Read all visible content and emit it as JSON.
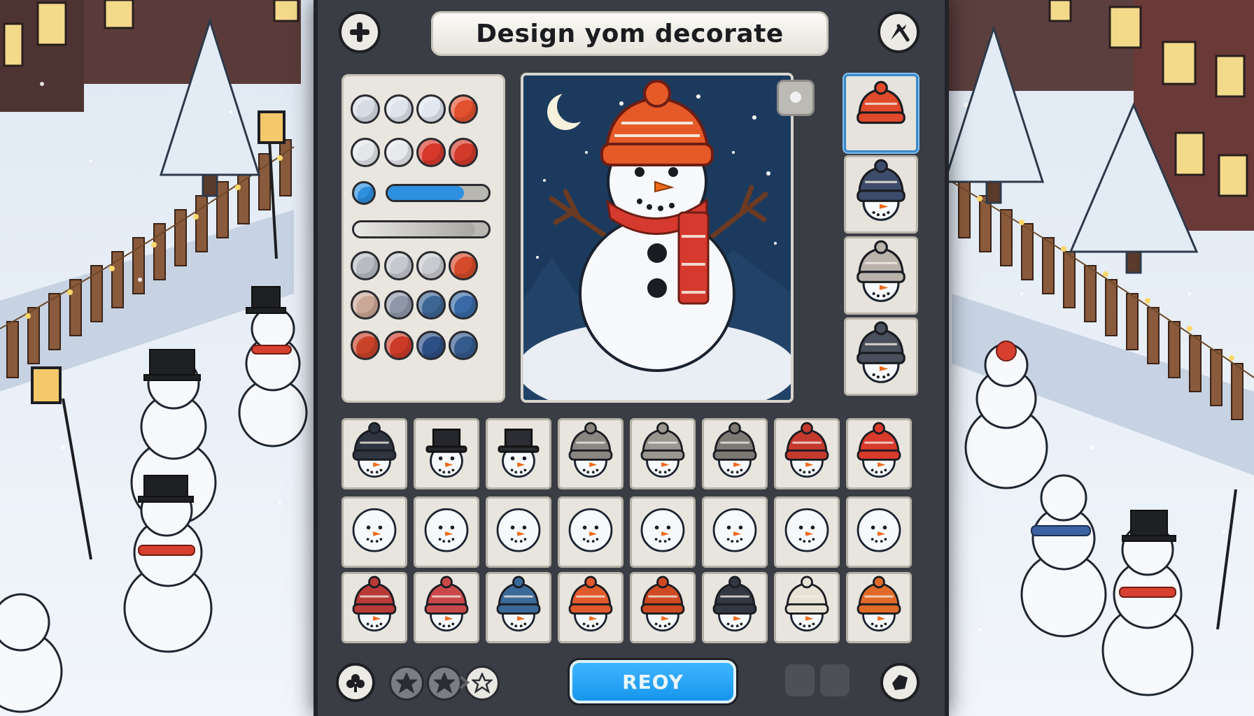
{
  "header": {
    "title": "Design  yom decorate",
    "left_icon": "plus-icon",
    "right_icon": "tool-icon"
  },
  "palette": {
    "rows": [
      [
        "#d7dce4",
        "#dfe4ec",
        "#e2e8f2",
        "#e2502e"
      ],
      [
        "#e4e6ea",
        "#e7e9ed",
        "#d8382c",
        "#d23a2a"
      ],
      [
        "#b8bcc2",
        "#c5c8cd",
        "#c9cbd0",
        "#d44a2a"
      ],
      [
        "#caa897",
        "#8f97a8",
        "#3e6695",
        "#3a6aa6"
      ],
      [
        "#c9432a",
        "#cc3b28",
        "#2c4f86",
        "#355a8c"
      ]
    ],
    "slider_dot_color": "#2d8fe0",
    "slider1_level": 0.76,
    "slider2_level": 0.9
  },
  "preview": {
    "hat_color": "#e65a28",
    "scarf_color": "#d63a2e",
    "sky_color": "#1b3a5e"
  },
  "side_hats": [
    {
      "name": "red-beanie",
      "color": "#e04a2a",
      "with_face": false
    },
    {
      "name": "navy-beanie",
      "color": "#3d4c6a",
      "with_face": true
    },
    {
      "name": "grey-pompom-beanie",
      "color": "#b9b3ab",
      "with_face": true
    },
    {
      "name": "dark-knit-beanie",
      "color": "#4a4f5c",
      "with_face": true
    }
  ],
  "grid": {
    "rows": [
      [
        {
          "hat": "beanie",
          "color": "#2e3440"
        },
        {
          "hat": "tophat",
          "color": "#26272c"
        },
        {
          "hat": "tophat",
          "color": "#2c2d33"
        },
        {
          "hat": "beanie",
          "color": "#8a8682"
        },
        {
          "hat": "beanie",
          "color": "#9a9690"
        },
        {
          "hat": "beanie",
          "color": "#7c7874"
        },
        {
          "hat": "beanie",
          "color": "#c53a2e"
        },
        {
          "hat": "beanie",
          "color": "#d93a2c"
        }
      ],
      [
        {
          "hat": "none"
        },
        {
          "hat": "none"
        },
        {
          "hat": "none"
        },
        {
          "hat": "none"
        },
        {
          "hat": "none"
        },
        {
          "hat": "none"
        },
        {
          "hat": "none"
        },
        {
          "hat": "none"
        }
      ],
      [
        {
          "hat": "beanie",
          "color": "#b83a38"
        },
        {
          "hat": "beanie",
          "color": "#c9494a"
        },
        {
          "hat": "beanie",
          "color": "#3a6a9a"
        },
        {
          "hat": "beanie",
          "color": "#e25a2c"
        },
        {
          "hat": "beanie",
          "color": "#cf4a22"
        },
        {
          "hat": "beanie",
          "color": "#333742"
        },
        {
          "hat": "beanie",
          "color": "#e8e2d6"
        },
        {
          "hat": "beanie",
          "color": "#e06a28"
        }
      ]
    ]
  },
  "bottom_bar": {
    "ready_label": "REOY",
    "left_icon": "club-icon",
    "right_icon": "tag-icon",
    "stars": [
      "filled",
      "filled",
      "outline"
    ]
  },
  "colors": {
    "panel": "#3a3d44",
    "accent": "#1796ec"
  }
}
